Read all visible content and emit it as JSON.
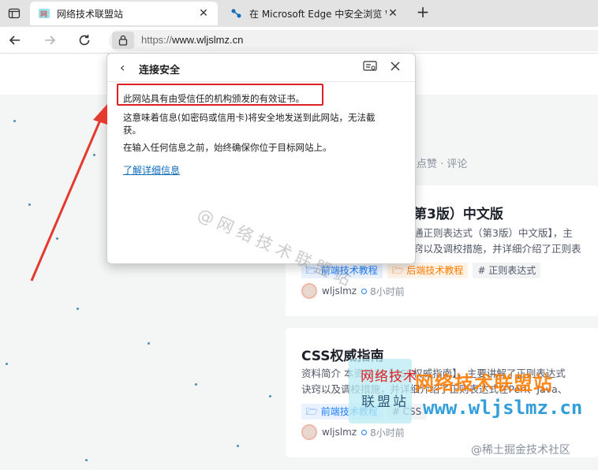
{
  "browser": {
    "tabs": [
      {
        "title": "网络技术联盟站"
      },
      {
        "title": "在 Microsoft Edge 中安全浏览 W"
      }
    ],
    "address": {
      "scheme": "https://",
      "host": "www.wljslmz.cn"
    }
  },
  "popup": {
    "title": "连接安全",
    "lines": [
      "此网站具有由受信任的机构颁发的有效证书。",
      "这意味着信息(如密码或信用卡)将安全地发送到此网站，无法截",
      "获。",
      "在输入任何信息之前，始终确保你位于目标网站上。"
    ],
    "link": "了解详细信息"
  },
  "page": {
    "meta_line": "点赞 · 评论",
    "cards": [
      {
        "title": "第3版）中文版",
        "desc_lines": [
          "通正则表达式（第3版）中文版】，主",
          "窍以及调校措施，并详细介绍了正则表"
        ],
        "tags": [
          "前端技术教程",
          "后端技术教程",
          "# 正则表达式"
        ],
        "author": "wljslmz",
        "time": "8小时前"
      },
      {
        "title": "CSS权威指南",
        "desc_lines": [
          "资料简介 本资料为【CSS权威指南】，主要讲解了正则表达式",
          "诀窍以及调校措施，并详细介绍了正则表达式在Perl、Java、"
        ],
        "tags": [
          "前端技术教程",
          "# CSS"
        ],
        "author": "wljslmz",
        "time": "8小时前"
      }
    ]
  },
  "watermark": "@网络技术联盟站",
  "logo": {
    "line1": "网络技术",
    "line2": "联盟站"
  },
  "brand": {
    "cn": "网络技术联盟站",
    "en": "www.wljslmz.cn"
  },
  "credit": "@稀土掘金技术社区",
  "colors": {
    "highlight": "#e02020",
    "link": "#0f6cbd",
    "brand_orange": "#ff7a00",
    "brand_blue": "#1892d6"
  }
}
